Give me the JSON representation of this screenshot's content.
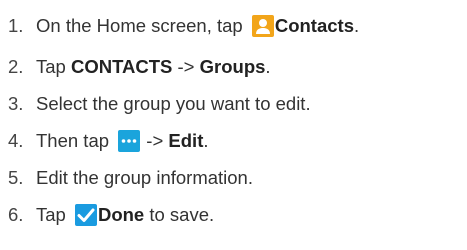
{
  "steps": [
    {
      "number": "1.",
      "before": "On the Home screen, tap ",
      "icon": "contacts-icon",
      "bold": "Contacts",
      "after": "."
    },
    {
      "number": "2.",
      "before": "Tap ",
      "bold1": "CONTACTS",
      "arrow": " -> ",
      "bold2": "Groups",
      "after": "."
    },
    {
      "number": "3.",
      "text": "Select the group you want to edit."
    },
    {
      "number": "4.",
      "before": "Then tap ",
      "icon": "more-options-icon",
      "arrow": " -> ",
      "bold": "Edit",
      "after": "."
    },
    {
      "number": "5.",
      "text": "Edit the group information."
    },
    {
      "number": "6.",
      "before": "Tap ",
      "icon": "checkmark-icon",
      "bold": "Done",
      "after": " to save."
    }
  ],
  "colors": {
    "contacts_icon": "#f2a51a",
    "more_icon": "#1aa4dc",
    "check_icon": "#1a9be0",
    "text": "#333333"
  }
}
